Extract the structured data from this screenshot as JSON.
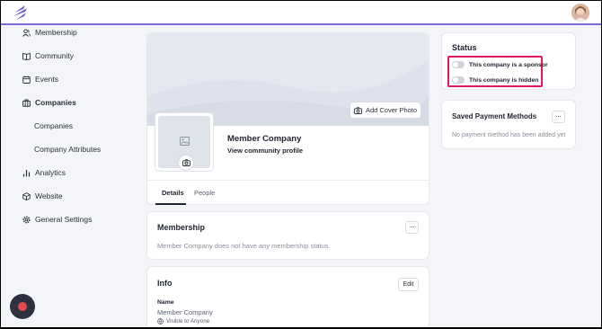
{
  "colors": {
    "accent": "#7c6cd6",
    "highlight": "#e0185f",
    "record": "#e24b4b"
  },
  "sidebar": {
    "items": [
      {
        "label": "Membership",
        "icon": "users-icon"
      },
      {
        "label": "Community",
        "icon": "book-icon"
      },
      {
        "label": "Events",
        "icon": "calendar-icon"
      },
      {
        "label": "Companies",
        "icon": "briefcase-icon",
        "active": true
      },
      {
        "label": "Companies",
        "icon": ""
      },
      {
        "label": "Company Attributes",
        "icon": ""
      },
      {
        "label": "Analytics",
        "icon": "bar-chart-icon"
      },
      {
        "label": "Website",
        "icon": "cube-icon"
      },
      {
        "label": "General Settings",
        "icon": "gear-icon"
      }
    ]
  },
  "profile": {
    "cover_button": "Add Cover Photo",
    "name": "Member Company",
    "view_link": "View community profile",
    "tabs": [
      "Details",
      "People"
    ]
  },
  "membership": {
    "title": "Membership",
    "empty": "Member Company does not have any membership status",
    "more_label": "..."
  },
  "info": {
    "title": "Info",
    "edit_label": "Edit",
    "name_label": "Name",
    "name_value": "Member Company",
    "visibility": "Visible to Anyone"
  },
  "status": {
    "title": "Status",
    "sponsor_label": "This company is a sponsor",
    "hidden_label": "This company is hidden",
    "sponsor_on": false,
    "hidden_on": false
  },
  "payment": {
    "title": "Saved Payment Methods",
    "empty": "No payment method has been added yet",
    "more_label": "..."
  }
}
